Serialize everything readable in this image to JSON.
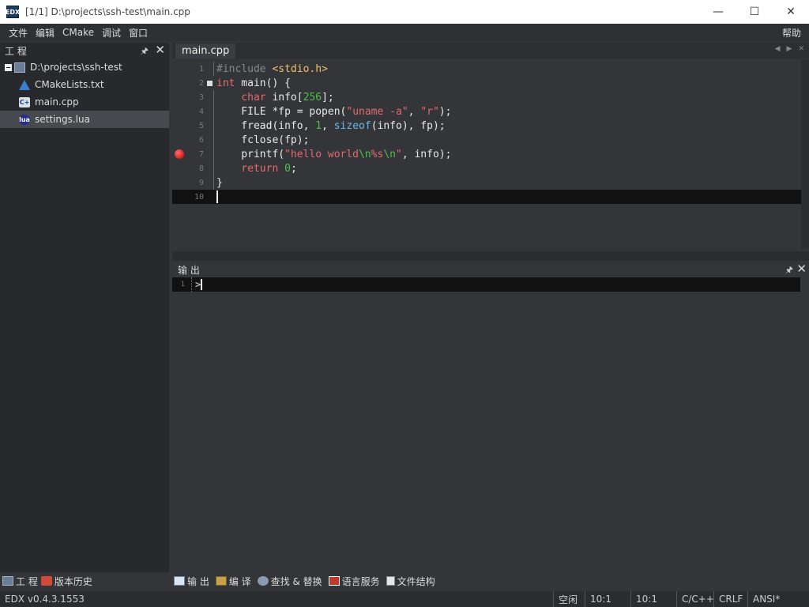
{
  "window": {
    "app_icon_text": "EDX",
    "title": "[1/1] D:\\projects\\ssh-test\\main.cpp",
    "minimize": "—",
    "maximize": "☐",
    "close": "✕"
  },
  "menu": {
    "items": [
      "文件",
      "编辑",
      "CMake",
      "调试",
      "窗口"
    ],
    "help": "帮助"
  },
  "project_panel": {
    "title": "工 程",
    "pin": "🖈",
    "close": "✕",
    "root": "D:\\projects\\ssh-test",
    "files": [
      {
        "name": "CMakeLists.txt",
        "icon": "cmake-icon"
      },
      {
        "name": "main.cpp",
        "icon": "cpp-file-icon"
      },
      {
        "name": "settings.lua",
        "icon": "lua-file-icon",
        "selected": true
      }
    ]
  },
  "editor": {
    "tab": "main.cpp",
    "line_numbers": [
      "1",
      "2",
      "3",
      "4",
      "5",
      "6",
      "7",
      "8",
      "9",
      "10"
    ],
    "breakpoint_line": 7,
    "current_line": 10,
    "code": {
      "l1_pp": "#include ",
      "l1_hdr": "<stdio.h>",
      "l2_kw": "int",
      "l2_rest": " main() {",
      "l3_indent": "    ",
      "l3_kw": "char",
      "l3_a": " info[",
      "l3_num": "256",
      "l3_b": "];",
      "l4_a": "    FILE *fp = popen(",
      "l4_s1": "\"uname -a\"",
      "l4_b": ", ",
      "l4_s2": "\"r\"",
      "l4_c": ");",
      "l5_a": "    fread(info, ",
      "l5_num": "1",
      "l5_b": ", ",
      "l5_fn": "sizeof",
      "l5_c": "(info), fp);",
      "l6": "    fclose(fp);",
      "l7_a": "    printf(",
      "l7_s1": "\"hello world",
      "l7_e1": "\\n",
      "l7_s2": "%s",
      "l7_e2": "\\n",
      "l7_s3": "\"",
      "l7_b": ", info);",
      "l8_indent": "    ",
      "l8_kw": "return",
      "l8_sp": " ",
      "l8_num": "0",
      "l8_b": ";",
      "l9": "}"
    }
  },
  "output_panel": {
    "title": "输 出",
    "pin": "🖈",
    "close": "✕",
    "line_number": "1",
    "prompt": ">"
  },
  "bottom_tabs": {
    "left": [
      "工 程",
      "版本历史"
    ],
    "right": [
      "输 出",
      "编 译",
      "查找 & 替换",
      "语言服务",
      "文件结构"
    ]
  },
  "status": {
    "version": "EDX v0.4.3.1553",
    "state": "空闲",
    "pos1": "10:1",
    "pos2": "10:1",
    "language": "C/C++",
    "line_ending": "CRLF",
    "encoding": "ANSI*"
  },
  "colors": {
    "keyword": "#e46a72",
    "number": "#4ac04a",
    "function": "#6cb8ea",
    "header": "#f0c070",
    "background": "#333538"
  }
}
